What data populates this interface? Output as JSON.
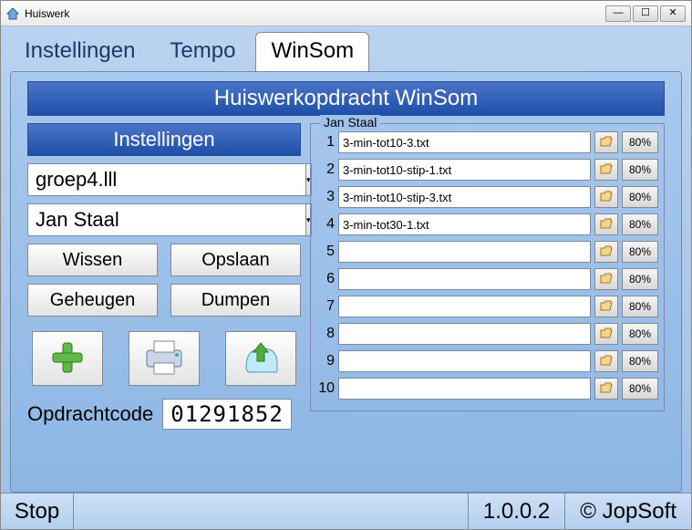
{
  "window": {
    "title": "Huiswerk"
  },
  "tabs": [
    {
      "label": "Instellingen"
    },
    {
      "label": "Tempo"
    },
    {
      "label": "WinSom"
    }
  ],
  "header_banner": "Huiswerkopdracht WinSom",
  "left": {
    "panel_title": "Instellingen",
    "group_combo": "groep4.lll",
    "student_combo": "Jan Staal",
    "btn_wissen": "Wissen",
    "btn_opslaan": "Opslaan",
    "btn_geheugen": "Geheugen",
    "btn_dumpen": "Dumpen",
    "code_label": "Opdrachtcode",
    "code_value": "01291852"
  },
  "right": {
    "legend": "Jan Staal",
    "rows": [
      {
        "n": "1",
        "file": "3-min-tot10-3.txt",
        "pct": "80%"
      },
      {
        "n": "2",
        "file": "3-min-tot10-stip-1.txt",
        "pct": "80%"
      },
      {
        "n": "3",
        "file": "3-min-tot10-stip-3.txt",
        "pct": "80%"
      },
      {
        "n": "4",
        "file": "3-min-tot30-1.txt",
        "pct": "80%"
      },
      {
        "n": "5",
        "file": "",
        "pct": "80%"
      },
      {
        "n": "6",
        "file": "",
        "pct": "80%"
      },
      {
        "n": "7",
        "file": "",
        "pct": "80%"
      },
      {
        "n": "8",
        "file": "",
        "pct": "80%"
      },
      {
        "n": "9",
        "file": "",
        "pct": "80%"
      },
      {
        "n": "10",
        "file": "",
        "pct": "80%"
      }
    ]
  },
  "status": {
    "stop": "Stop",
    "version": "1.0.0.2",
    "copyright": "© JopSoft"
  }
}
